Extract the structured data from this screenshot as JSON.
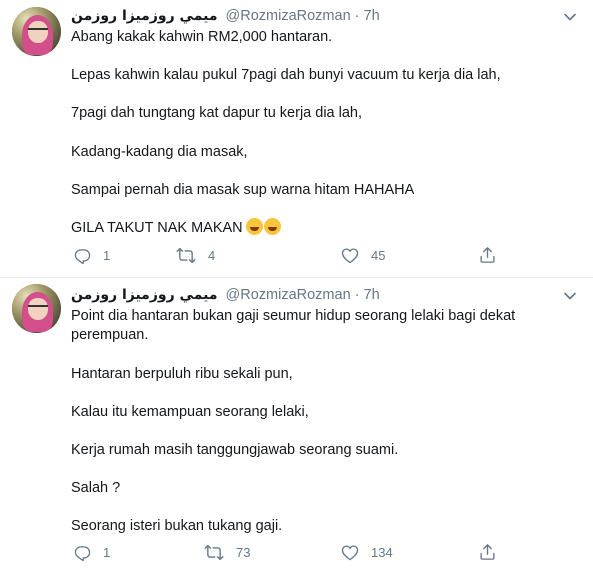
{
  "tweets": [
    {
      "display_name": "ميمي روزميزا روزمن",
      "handle": "@RozmizaRozman",
      "separator": "·",
      "time": "7h",
      "lines": [
        "Abang kakak kahwin RM2,000 hantaran.",
        "Lepas kahwin kalau pukul 7pagi dah bunyi vacuum tu kerja dia lah,",
        "7pagi dah tungtang kat dapur tu kerja dia lah,",
        "Kadang-kadang dia masak,",
        "Sampai pernah dia masak sup warna hitam HAHAHA",
        "GILA TAKUT NAK MAKAN"
      ],
      "emojis": [
        "rolling-on-floor-laughing-emoji",
        "tears-of-joy-emoji"
      ],
      "replies": "1",
      "retweets": "4",
      "likes": "45"
    },
    {
      "display_name": "ميمي روزميزا روزمن",
      "handle": "@RozmizaRozman",
      "separator": "·",
      "time": "7h",
      "lines": [
        "Point dia hantaran bukan gaji seumur hidup seorang lelaki bagi dekat perempuan.",
        "Hantaran berpuluh ribu sekali pun,",
        "Kalau itu kemampuan seorang lelaki,",
        "Kerja rumah masih tanggungjawab seorang suami.",
        "Salah ?",
        "Seorang isteri bukan tukang gaji."
      ],
      "replies": "1",
      "retweets": "73",
      "likes": "134"
    }
  ],
  "icons": {
    "reply": "reply-icon",
    "retweet": "retweet-icon",
    "like": "heart-icon",
    "share": "share-icon",
    "menu": "chevron-down-icon"
  },
  "colors": {
    "text": "#14171a",
    "secondary": "#657786",
    "divider": "#e6ecf0"
  }
}
